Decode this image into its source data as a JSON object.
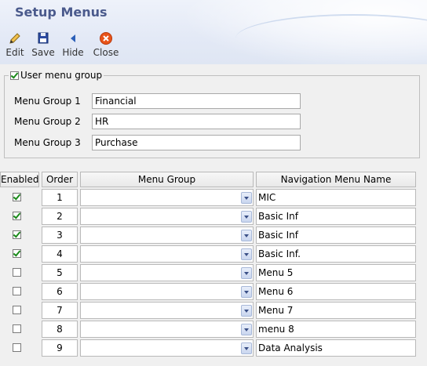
{
  "title": "Setup Menus",
  "toolbar": {
    "edit": "Edit",
    "save": "Save",
    "hide": "Hide",
    "close": "Close"
  },
  "user_menu_group": {
    "label": "User menu group",
    "checked": true,
    "groups": [
      {
        "label": "Menu Group 1",
        "value": "Financial"
      },
      {
        "label": "Menu Group 2",
        "value": "HR"
      },
      {
        "label": "Menu Group 3",
        "value": "Purchase"
      }
    ]
  },
  "table": {
    "headers": {
      "enabled": "Enabled",
      "order": "Order",
      "menu_group": "Menu Group",
      "nav_name": "Navigation Menu Name"
    },
    "rows": [
      {
        "enabled": true,
        "order": "1",
        "menu_group": "",
        "nav_name": "MIC"
      },
      {
        "enabled": true,
        "order": "2",
        "menu_group": "",
        "nav_name": "Basic Inf"
      },
      {
        "enabled": true,
        "order": "3",
        "menu_group": "",
        "nav_name": "Basic Inf"
      },
      {
        "enabled": true,
        "order": "4",
        "menu_group": "",
        "nav_name": "Basic Inf."
      },
      {
        "enabled": false,
        "order": "5",
        "menu_group": "",
        "nav_name": "Menu 5"
      },
      {
        "enabled": false,
        "order": "6",
        "menu_group": "",
        "nav_name": "Menu 6"
      },
      {
        "enabled": false,
        "order": "7",
        "menu_group": "",
        "nav_name": "Menu 7"
      },
      {
        "enabled": false,
        "order": "8",
        "menu_group": "",
        "nav_name": "menu 8"
      },
      {
        "enabled": false,
        "order": "9",
        "menu_group": "",
        "nav_name": "Data Analysis"
      }
    ]
  },
  "colors": {
    "title": "#4a5a8c",
    "check": "#1a8a1a",
    "close_icon": "#e8541a",
    "save_icon": "#2b4aa0"
  }
}
